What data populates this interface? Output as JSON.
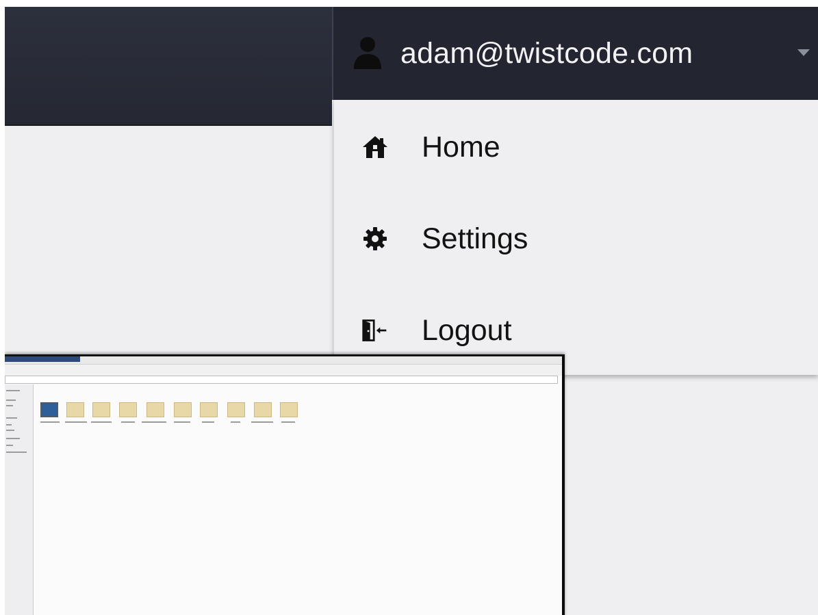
{
  "header": {
    "user_email": "adam@twistcode.com",
    "user_icon": "user-icon",
    "caret_icon": "caret-down-icon"
  },
  "dropdown": {
    "items": [
      {
        "label": "Home",
        "icon": "home-icon"
      },
      {
        "label": "Settings",
        "icon": "gear-icon"
      },
      {
        "label": "Logout",
        "icon": "logout-icon"
      }
    ]
  },
  "colors": {
    "topbar": "#252833",
    "dropdown_bg": "#efeff2",
    "page_bg": "#efeff2",
    "text_light": "#f2f2f5",
    "text_dark": "#121212"
  },
  "thumbnail": {
    "icon": "file-browser-screenshot",
    "folder_count": 10
  }
}
